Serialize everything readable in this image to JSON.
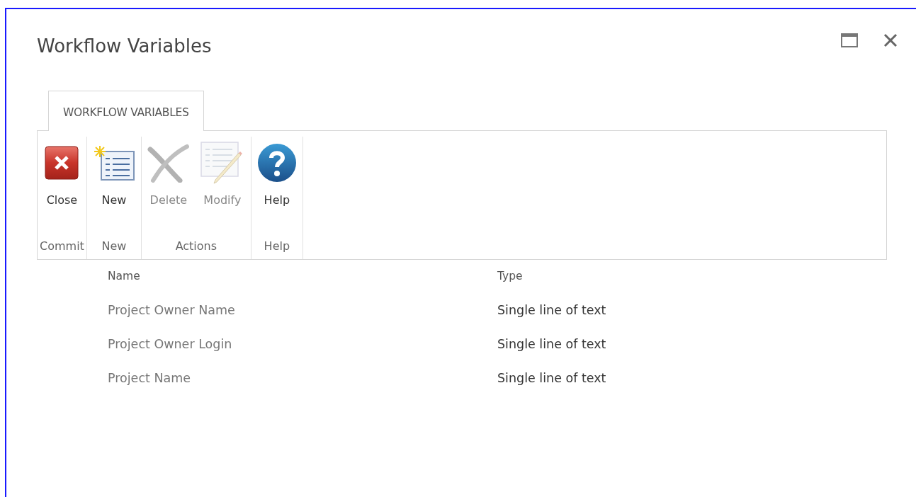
{
  "window": {
    "title": "Workflow Variables"
  },
  "tabs": [
    {
      "label": "WORKFLOW VARIABLES",
      "selected": true
    }
  ],
  "ribbon_groups": [
    {
      "label": "Commit",
      "buttons": [
        {
          "label": "Close",
          "kind": "close",
          "disabled": false
        }
      ]
    },
    {
      "label": "New",
      "buttons": [
        {
          "label": "New",
          "kind": "new",
          "disabled": false
        }
      ]
    },
    {
      "label": "Actions",
      "buttons": [
        {
          "label": "Delete",
          "kind": "delete",
          "disabled": true
        },
        {
          "label": "Modify",
          "kind": "modify",
          "disabled": true
        }
      ]
    },
    {
      "label": "Help",
      "buttons": [
        {
          "label": "Help",
          "kind": "help",
          "disabled": false
        }
      ]
    }
  ],
  "table": {
    "columns": [
      "Name",
      "Type"
    ],
    "rows": [
      {
        "name": "Project Owner Name",
        "type": "Single line of text"
      },
      {
        "name": "Project Owner Login",
        "type": "Single line of text"
      },
      {
        "name": "Project Name",
        "type": "Single line of text"
      }
    ]
  }
}
